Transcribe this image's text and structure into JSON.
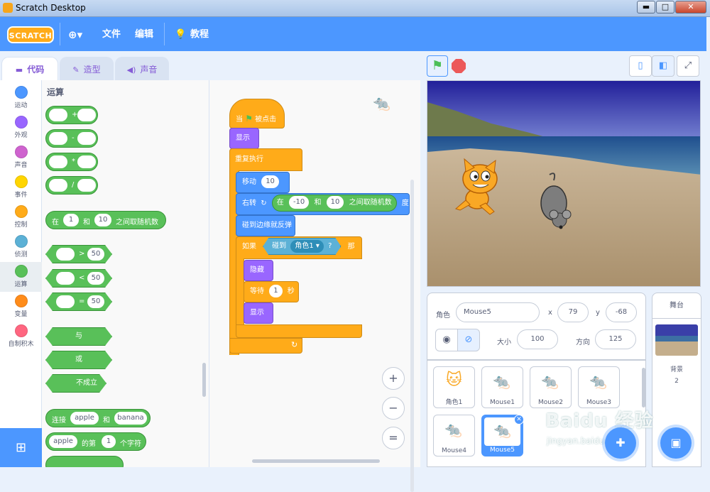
{
  "window": {
    "title": "Scratch Desktop",
    "min": "▬",
    "max": "□",
    "close": "✕"
  },
  "menu": {
    "logo": "SCRATCH",
    "globe": "⊕▾",
    "file": "文件",
    "edit": "编辑",
    "tutorials": "教程"
  },
  "tabs": {
    "code": "代码",
    "costumes": "造型",
    "sounds": "声音"
  },
  "categories": [
    {
      "label": "运动",
      "color": "#4c97ff"
    },
    {
      "label": "外观",
      "color": "#9966ff"
    },
    {
      "label": "声音",
      "color": "#cf63cf"
    },
    {
      "label": "事件",
      "color": "#ffd500"
    },
    {
      "label": "控制",
      "color": "#ffab19"
    },
    {
      "label": "侦测",
      "color": "#5cb1d6"
    },
    {
      "label": "运算",
      "color": "#59c059"
    },
    {
      "label": "变量",
      "color": "#ff8c1a"
    },
    {
      "label": "自制积木",
      "color": "#ff6680"
    }
  ],
  "palette": {
    "title": "运算",
    "ops": [
      "+",
      "-",
      "*",
      "/"
    ],
    "random": {
      "pre": "在",
      "a": "1",
      "mid": "和",
      "b": "10",
      "post": "之间取随机数"
    },
    "compare": [
      {
        "op": ">",
        "val": "50"
      },
      {
        "op": "<",
        "val": "50"
      },
      {
        "op": "=",
        "val": "50"
      }
    ],
    "logic": {
      "and": "与",
      "or": "或",
      "not": "不成立"
    },
    "join": {
      "pre": "连接",
      "a": "apple",
      "mid": "和",
      "b": "banana"
    },
    "letter": {
      "a": "apple",
      "mid": "的第",
      "n": "1",
      "post": "个字符"
    }
  },
  "script": {
    "hat": {
      "pre": "当",
      "post": "被点击"
    },
    "show1": "显示",
    "forever": "重复执行",
    "move": {
      "label": "移动",
      "val": "10",
      "unit": "步"
    },
    "turn": {
      "label": "右转",
      "pre": "在",
      "a": "-10",
      "mid": "和",
      "b": "10",
      "post": "之间取随机数",
      "unit": "度"
    },
    "bounce": "碰到边缘就反弹",
    "if": {
      "label": "如果",
      "touch": "碰到",
      "target": "角色1 ▾",
      "q": "?",
      "then": "那么"
    },
    "hide": "隐藏",
    "wait": {
      "label": "等待",
      "val": "1",
      "unit": "秒"
    },
    "show2": "显示"
  },
  "zoom": {
    "in": "+",
    "out": "−",
    "reset": "="
  },
  "sprite_info": {
    "label_sprite": "角色",
    "name": "Mouse5",
    "label_x": "x",
    "x": "79",
    "label_y": "y",
    "y": "-68",
    "label_size": "大小",
    "size": "100",
    "label_dir": "方向",
    "direction": "125"
  },
  "sprites": [
    {
      "name": "角色1"
    },
    {
      "name": "Mouse1"
    },
    {
      "name": "Mouse2"
    },
    {
      "name": "Mouse3"
    },
    {
      "name": "Mouse4"
    },
    {
      "name": "Mouse5"
    }
  ],
  "stage_panel": {
    "title": "舞台",
    "backdrop_label": "背景",
    "backdrop_count": "2"
  },
  "watermark": {
    "brand": "Baidu 经验",
    "url": "jingyan.baidu.com"
  }
}
